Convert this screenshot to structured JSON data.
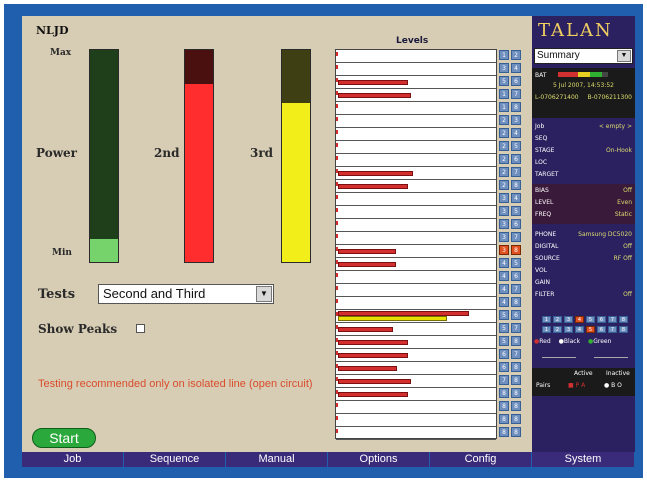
{
  "app": {
    "brand": "TALAN",
    "panel_title": "NLJD",
    "levels_title": "Levels"
  },
  "meters": {
    "max_label": "Max",
    "min_label": "Min",
    "power": {
      "label": "Power",
      "level": 0.11,
      "color": "#76d36b",
      "bg": "#1f3f1a"
    },
    "second": {
      "label": "2nd",
      "level": 0.84,
      "color": "#ff2d2d",
      "bg": "#4a1010"
    },
    "third": {
      "label": "3rd",
      "level": 0.75,
      "color": "#f2ee1a",
      "bg": "#3f3f14"
    }
  },
  "levels": {
    "rows": [
      {
        "left": 0.0,
        "right": 0.0
      },
      {
        "left": 0.0,
        "right": 0.0
      },
      {
        "left": 0.45,
        "right": 0.0
      },
      {
        "left": 0.47,
        "right": 0.0
      },
      {
        "left": 0.0,
        "right": 0.0
      },
      {
        "left": 0.0,
        "right": 0.0
      },
      {
        "left": 0.0,
        "right": 0.0
      },
      {
        "left": 0.0,
        "right": 0.0
      },
      {
        "left": 0.0,
        "right": 0.0
      },
      {
        "left": 0.48,
        "right": 0.0
      },
      {
        "left": 0.45,
        "right": 0.0
      },
      {
        "left": 0.0,
        "right": 0.0
      },
      {
        "left": 0.0,
        "right": 0.0
      },
      {
        "left": 0.0,
        "right": 0.0
      },
      {
        "left": 0.0,
        "right": 0.0
      },
      {
        "left": 0.37,
        "right": 0.0
      },
      {
        "left": 0.37,
        "right": 0.0
      },
      {
        "left": 0.0,
        "right": 0.0
      },
      {
        "left": 0.0,
        "right": 0.0
      },
      {
        "left": 0.0,
        "right": 0.0
      },
      {
        "left": 0.84,
        "right": 0.7,
        "highlight": true
      },
      {
        "left": 0.35,
        "right": 0.0
      },
      {
        "left": 0.45,
        "right": 0.0
      },
      {
        "left": 0.45,
        "right": 0.0
      },
      {
        "left": 0.38,
        "right": 0.0
      },
      {
        "left": 0.47,
        "right": 0.0
      },
      {
        "left": 0.45,
        "right": 0.0
      },
      {
        "left": 0.0,
        "right": 0.0
      },
      {
        "left": 0.0,
        "right": 0.0
      },
      {
        "left": 0.0,
        "right": 0.0
      }
    ],
    "pin_pairs": [
      [
        "1",
        "2"
      ],
      [
        "3",
        "4"
      ],
      [
        "5",
        "6"
      ],
      [
        "1",
        "7"
      ],
      [
        "1",
        "8"
      ],
      [
        "2",
        "3"
      ],
      [
        "2",
        "4"
      ],
      [
        "2",
        "5"
      ],
      [
        "2",
        "6"
      ],
      [
        "2",
        "7"
      ],
      [
        "2",
        "8"
      ],
      [
        "3",
        "4"
      ],
      [
        "3",
        "5"
      ],
      [
        "3",
        "6"
      ],
      [
        "3",
        "7"
      ],
      [
        "3",
        "8"
      ],
      [
        "4",
        "5"
      ],
      [
        "4",
        "6"
      ],
      [
        "4",
        "7"
      ],
      [
        "4",
        "8"
      ],
      [
        "5",
        "6"
      ],
      [
        "5",
        "7"
      ],
      [
        "5",
        "8"
      ],
      [
        "6",
        "7"
      ],
      [
        "6",
        "8"
      ],
      [
        "7",
        "8"
      ],
      [
        "8",
        "8"
      ],
      [
        "8",
        "8"
      ],
      [
        "8",
        "8"
      ],
      [
        "8",
        "8"
      ]
    ],
    "active_pair_index": 15
  },
  "tests": {
    "label": "Tests",
    "value": "Second and Third",
    "show_peaks_label": "Show Peaks",
    "show_peaks_checked": false
  },
  "note": "Testing recommended only on isolated line (open circuit)",
  "start_label": "Start",
  "sidebar": {
    "dropdown_value": "Summary",
    "bat_label": "BAT",
    "datetime": "5 Jul 2007, 14:53:52",
    "lines": [
      "L-0706271400",
      "B-0706211300"
    ],
    "fields": [
      {
        "label": "Job",
        "value": "< empty >"
      },
      {
        "label": "SEQ",
        "value": ""
      },
      {
        "label": "STAGE",
        "value": "On-Hook"
      },
      {
        "label": "LOC",
        "value": ""
      },
      {
        "label": "TARGET",
        "value": ""
      }
    ],
    "bias_fields": [
      {
        "label": "BIAS",
        "value": "Off"
      },
      {
        "label": "LEVEL",
        "value": "Even"
      },
      {
        "label": "FREQ",
        "value": "Static"
      }
    ],
    "phone_fields": [
      {
        "label": "PHONE",
        "value": "Samsung DC5020"
      },
      {
        "label": "DIGITAL",
        "value": "Off"
      },
      {
        "label": "SOURCE",
        "value": "RF Off"
      },
      {
        "label": "VOL",
        "value": ""
      },
      {
        "label": "GAIN",
        "value": ""
      },
      {
        "label": "FILTER",
        "value": "Off"
      }
    ],
    "pin_rows": [
      [
        "1",
        "2",
        "3",
        "4",
        "5",
        "6",
        "7",
        "8"
      ],
      [
        "1",
        "2",
        "3",
        "4",
        "5",
        "6",
        "7",
        "8"
      ]
    ],
    "legend": [
      "Red",
      "Black",
      "Green"
    ],
    "active_label": "Active",
    "inactive_label": "Inactive",
    "pairs_label": "Pairs",
    "active_value": "P A",
    "inactive_value": "B O"
  },
  "nav": [
    "Job",
    "Sequence",
    "Manual",
    "Options",
    "Config",
    "System"
  ]
}
